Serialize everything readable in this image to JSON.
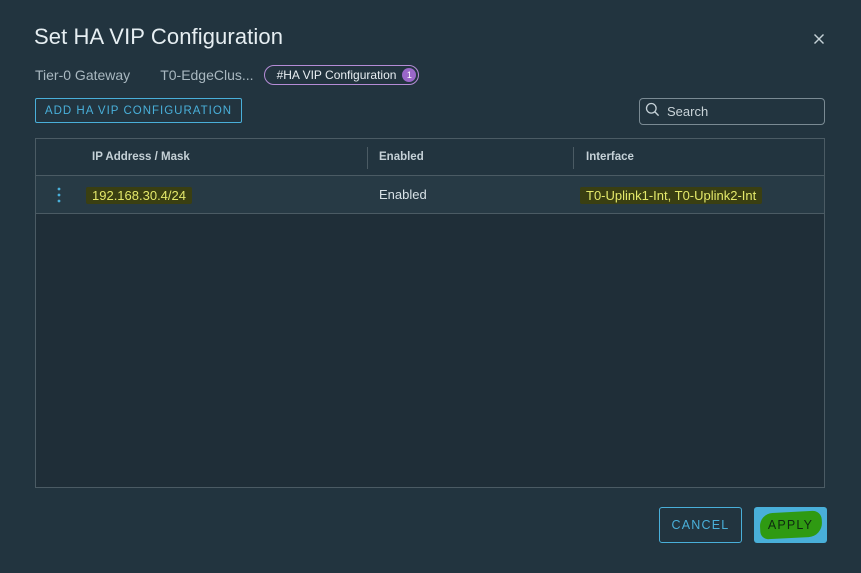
{
  "dialog": {
    "title": "Set HA VIP Configuration"
  },
  "context": {
    "gateway_label": "Tier-0 Gateway",
    "gateway_value": "T0-EdgeClus...",
    "pill_label": "#HA VIP Configuration",
    "pill_count": "1"
  },
  "toolbar": {
    "add_label": "ADD HA VIP CONFIGURATION",
    "search_placeholder": "Search"
  },
  "table": {
    "columns": [
      "IP Address / Mask",
      "Enabled",
      "Interface"
    ],
    "rows": [
      {
        "ip": "192.168.30.4/24",
        "enabled": "Enabled",
        "interface": "T0-Uplink1-Int, T0-Uplink2-Int"
      }
    ]
  },
  "footer": {
    "cancel_label": "CANCEL",
    "apply_label": "APPLY"
  },
  "colors": {
    "accent": "#49afd9",
    "pill_border": "#b58cd6",
    "badge": "#9a67c9",
    "highlight_text": "#e3e86a",
    "apply_scribble": "#2f9a12"
  },
  "icons": {
    "close": "close-icon",
    "search": "search-icon",
    "row_menu": "vertical-ellipsis-icon"
  }
}
